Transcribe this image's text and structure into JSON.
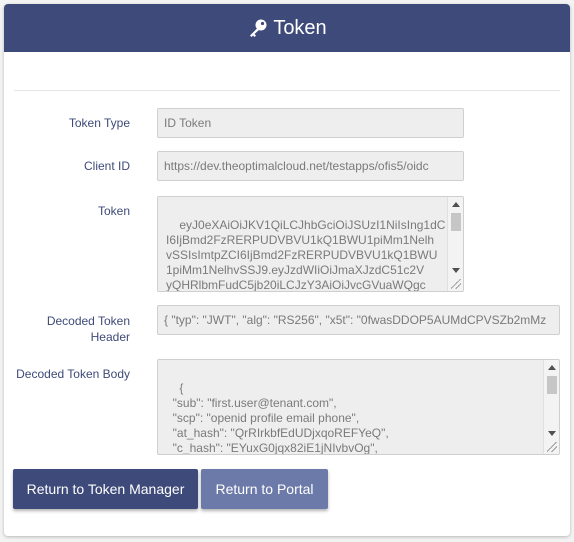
{
  "header": {
    "title": "Token",
    "icon": "key-icon"
  },
  "fields": {
    "token_type": {
      "label": "Token Type",
      "value": "ID Token"
    },
    "client_id": {
      "label": "Client ID",
      "value": "https://dev.theoptimalcloud.net/testapps/ofis5/oidc"
    },
    "token": {
      "label": "Token",
      "value": "eyJ0eXAiOiJKV1QiLCJhbGciOiJSUzI1NiIsIng1dC\nI6IjBmd2FzRERPUDVBVU1kQ1BWU1piMm1Nelh\nvSSIsImtpZCI6IjBmd2FzRERPUDVBVU1kQ1BWU\n1piMm1NelhvSSJ9.eyJzdWIiOiJmaXJzdC51c2V\nyQHRlbmFudC5jb20iLCJzY3AiOiJvcGVuaWQgc"
    },
    "decoded_header": {
      "label": "Decoded Token Header",
      "value": "{  \"typ\": \"JWT\",  \"alg\": \"RS256\",  \"x5t\": \"0fwasDDOP5AUMdCPVSZb2mMz"
    },
    "decoded_body": {
      "label": "Decoded Token Body",
      "value": "{\n  \"sub\": \"first.user@tenant.com\",\n  \"scp\": \"openid profile email phone\",\n  \"at_hash\": \"QrRIrkbfEdUDjxqoREFYeQ\",\n  \"c_hash\": \"EYuxG0jqx82iE1jNIvbvOg\","
    }
  },
  "buttons": {
    "return_token_manager": "Return to Token Manager",
    "return_portal": "Return to Portal"
  },
  "colors": {
    "primary": "#3e4a79",
    "secondary": "#6c7aa9"
  }
}
